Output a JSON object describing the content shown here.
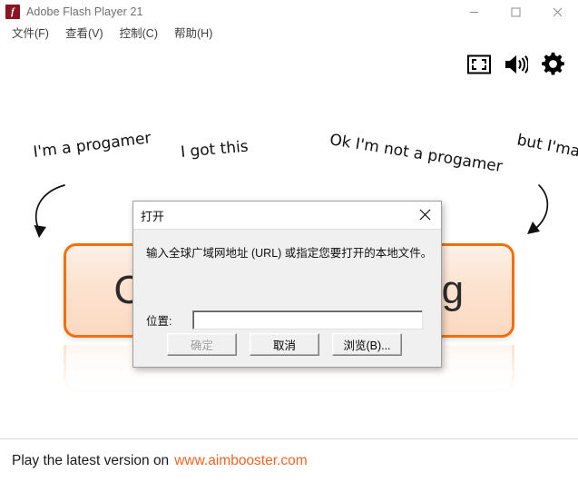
{
  "window": {
    "title": "Adobe Flash Player 21",
    "app_icon": "flash-icon",
    "icon_glyph": "f",
    "controls": {
      "minimize": "minimize-icon",
      "maximize": "maximize-icon",
      "close": "close-icon"
    }
  },
  "menubar": {
    "items": [
      {
        "label": "文件(F)"
      },
      {
        "label": "查看(V)"
      },
      {
        "label": "控制(C)"
      },
      {
        "label": "帮助(H)"
      }
    ]
  },
  "player_controls": [
    {
      "name": "fullscreen-icon",
      "label": "fullscreen-icon"
    },
    {
      "name": "volume-icon",
      "label": "volume-icon"
    },
    {
      "name": "gear-icon",
      "label": "gear-icon"
    }
  ],
  "stage": {
    "main_button": {
      "label": "Challenge a setting",
      "border_color": "#f26f0c",
      "fill_start": "#fdf0e6",
      "fill_end": "#fbd9c0",
      "text_color": "#2b2b2b"
    },
    "annotations": {
      "left": {
        "line1": "I'm a progamer",
        "line2": "I got this"
      },
      "right": {
        "line1": "Ok I'm not a progamer",
        "line2": "but I'ma become one"
      }
    }
  },
  "bottom_bar": {
    "text": "Play the latest version on",
    "link": "www.aimbooster.com",
    "link_color": "#f26522"
  },
  "dialog": {
    "title": "打开",
    "close_icon": "close-icon",
    "description": "输入全球广域网地址 (URL) 或指定您要打开的本地文件。",
    "location_label": "位置:",
    "location_value": "",
    "location_placeholder": "",
    "buttons": [
      {
        "label": "确定",
        "state": "disabled"
      },
      {
        "label": "取消",
        "state": "enabled"
      },
      {
        "label": "浏览(B)...",
        "state": "enabled"
      }
    ]
  }
}
